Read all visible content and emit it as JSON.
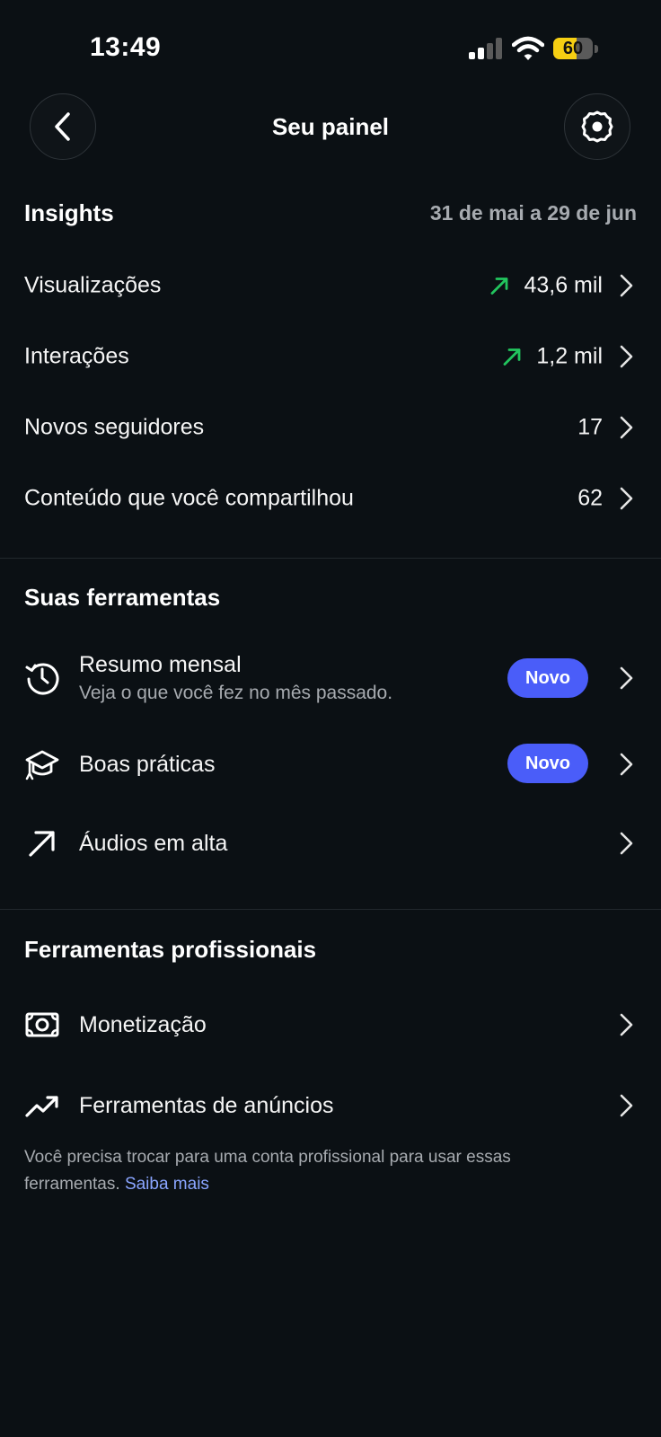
{
  "status_bar": {
    "time": "13:49",
    "battery_percent": 60,
    "battery_label": "60",
    "battery_color": "#f6cf12"
  },
  "header": {
    "title": "Seu painel",
    "back_icon": "chevron-left-icon",
    "settings_icon": "gear-icon"
  },
  "insights": {
    "title": "Insights",
    "date_range": "31 de mai a 29 de jun",
    "trend_color": "#22c55e",
    "rows": [
      {
        "label": "Visualizações",
        "value": "43,6 mil",
        "trend": "up"
      },
      {
        "label": "Interações",
        "value": "1,2 mil",
        "trend": "up"
      },
      {
        "label": "Novos seguidores",
        "value": "17"
      },
      {
        "label": "Conteúdo que você compartilhou",
        "value": "62"
      }
    ]
  },
  "tools": {
    "title": "Suas ferramentas",
    "items": [
      {
        "icon": "history-clock-icon",
        "label": "Resumo mensal",
        "sublabel": "Veja o que você fez no mês passado.",
        "badge": "Novo"
      },
      {
        "icon": "graduation-cap-icon",
        "label": "Boas práticas",
        "badge": "Novo"
      },
      {
        "icon": "arrow-up-right-icon",
        "label": "Áudios em alta"
      }
    ]
  },
  "pro_tools": {
    "title": "Ferramentas profissionais",
    "items": [
      {
        "icon": "money-icon",
        "label": "Monetização"
      },
      {
        "icon": "trending-up-icon",
        "label": "Ferramentas de anúncios"
      }
    ],
    "note": "Você precisa trocar para uma conta profissional para usar essas ferramentas.",
    "note_link": "Saiba mais"
  },
  "colors": {
    "background": "#0b1014",
    "badge": "#4a5df9",
    "link": "#8aa5ff",
    "muted_text": "#a7abb0"
  }
}
